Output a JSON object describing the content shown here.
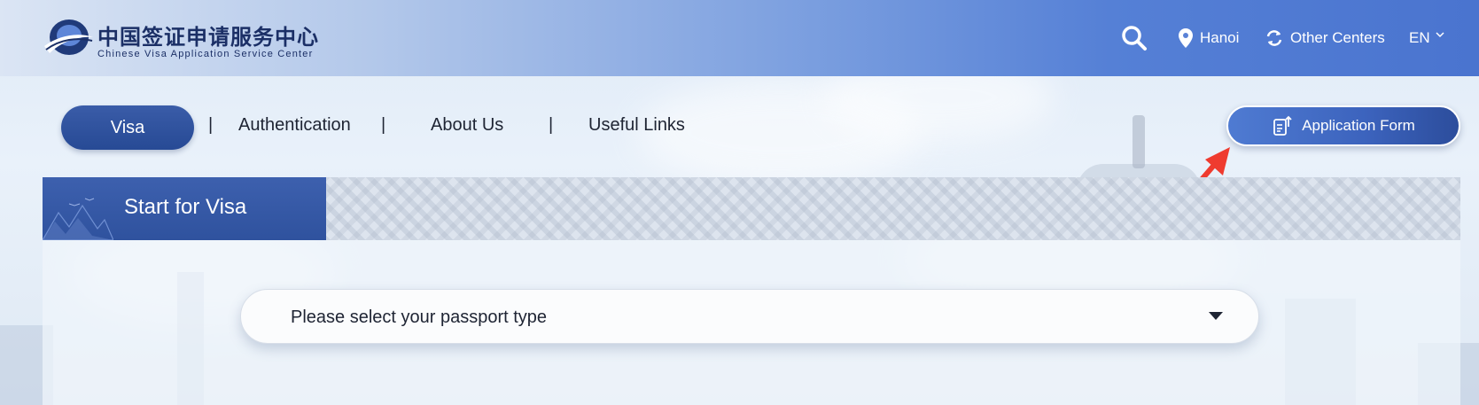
{
  "header": {
    "logo": {
      "title_cn": "中国签证申请服务中心",
      "title_en": "Chinese Visa Application Service Center",
      "icon": "globe-logo-icon"
    },
    "search_icon": "search-icon",
    "location": {
      "icon": "location-pin-icon",
      "label": "Hanoi"
    },
    "centers": {
      "icon": "refresh-icon",
      "label": "Other Centers"
    },
    "language": {
      "label": "EN",
      "icon": "chevron-down-icon"
    }
  },
  "nav": {
    "items": [
      {
        "label": "Visa",
        "active": true
      },
      {
        "label": "Authentication"
      },
      {
        "label": "About Us"
      },
      {
        "label": "Useful Links"
      }
    ],
    "separator": "|"
  },
  "application_button": {
    "icon": "form-upload-icon",
    "label": "Application Form"
  },
  "annotation": {
    "icon": "red-arrow-icon",
    "color": "#ef3b2f"
  },
  "panel": {
    "title": "Start for Visa",
    "select": {
      "placeholder": "Please select your passport type",
      "icon": "caret-down-icon"
    }
  },
  "colors": {
    "brand_dark": "#274a95",
    "header_gradient_end": "#4a74cf",
    "text": "#1e2433"
  }
}
